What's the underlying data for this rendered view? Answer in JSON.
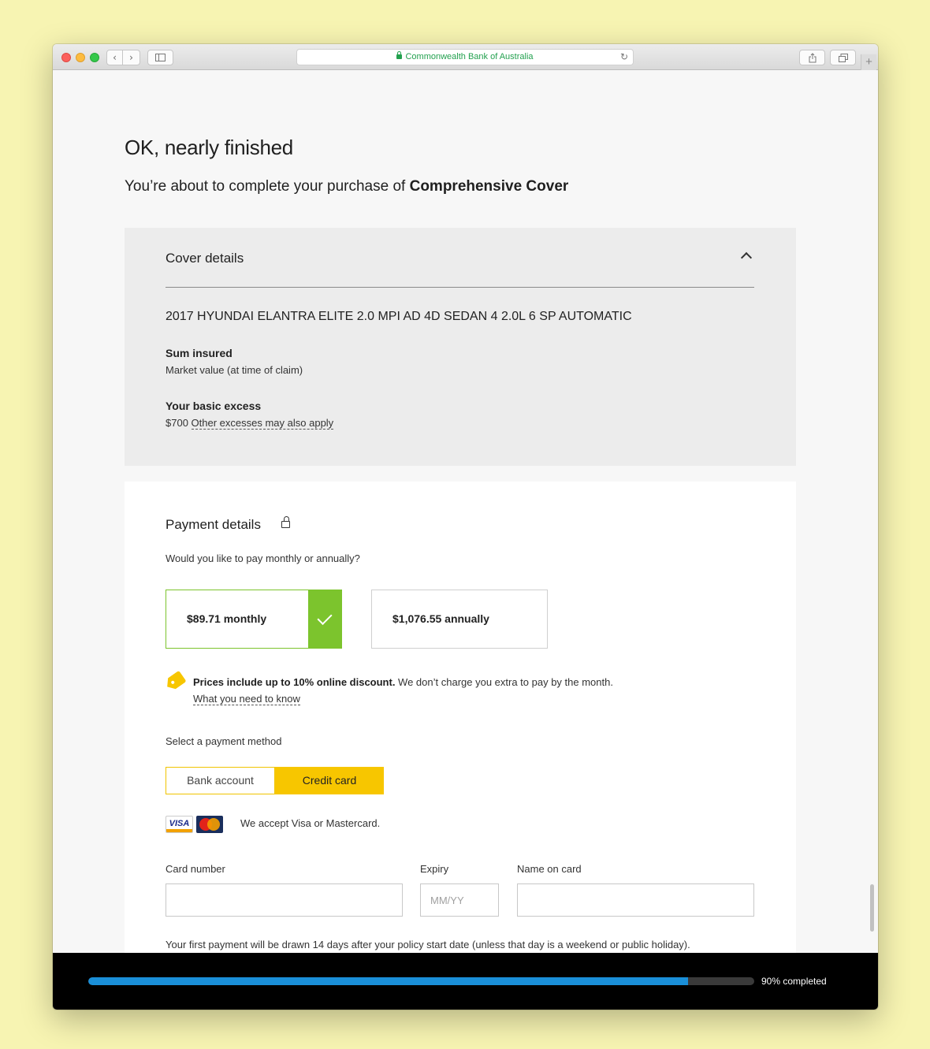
{
  "browser": {
    "url_text": "Commonwealth Bank of Australia",
    "back_glyph": "‹",
    "forward_glyph": "›",
    "reload_glyph": "↻",
    "new_tab_glyph": "+"
  },
  "page": {
    "heading": "OK, nearly finished",
    "subheading_prefix": "You’re about to complete your purchase of ",
    "subheading_product": "Comprehensive Cover"
  },
  "cover": {
    "title": "Cover details",
    "vehicle": "2017 HYUNDAI ELANTRA ELITE 2.0 MPI AD 4D SEDAN 4 2.0L 6 SP AUTOMATIC",
    "sum_insured_label": "Sum insured",
    "sum_insured_value": "Market value (at time of claim)",
    "excess_label": "Your basic excess",
    "excess_amount": "$700",
    "excess_link": "Other excesses may also apply"
  },
  "payment": {
    "title": "Payment details",
    "question": "Would you like to pay monthly or annually?",
    "options": [
      {
        "label": "$89.71 monthly",
        "selected": true
      },
      {
        "label": "$1,076.55 annually",
        "selected": false
      }
    ],
    "discount_bold": "Prices include up to 10% online discount.",
    "discount_text": " We don’t charge you extra to pay by the month.",
    "discount_link": "What you need to know",
    "method_label": "Select a payment method",
    "methods": [
      {
        "label": "Bank account",
        "selected": false
      },
      {
        "label": "Credit card",
        "selected": true
      }
    ],
    "accept_text": "We accept Visa or Mastercard.",
    "fields": {
      "card_number_label": "Card number",
      "card_number_value": "",
      "expiry_label": "Expiry",
      "expiry_placeholder": "MM/YY",
      "name_label": "Name on card",
      "name_value": ""
    },
    "first_payment_note": "Your first payment will be drawn 14 days after your policy start date (unless that day is a weekend or public holiday)."
  },
  "progress": {
    "percent": 90,
    "label": "90% completed"
  },
  "colors": {
    "accent_yellow": "#f7c600",
    "selected_green": "#7cc42d",
    "progress_blue": "#1a8fd8",
    "secure_green": "#23a14f"
  }
}
